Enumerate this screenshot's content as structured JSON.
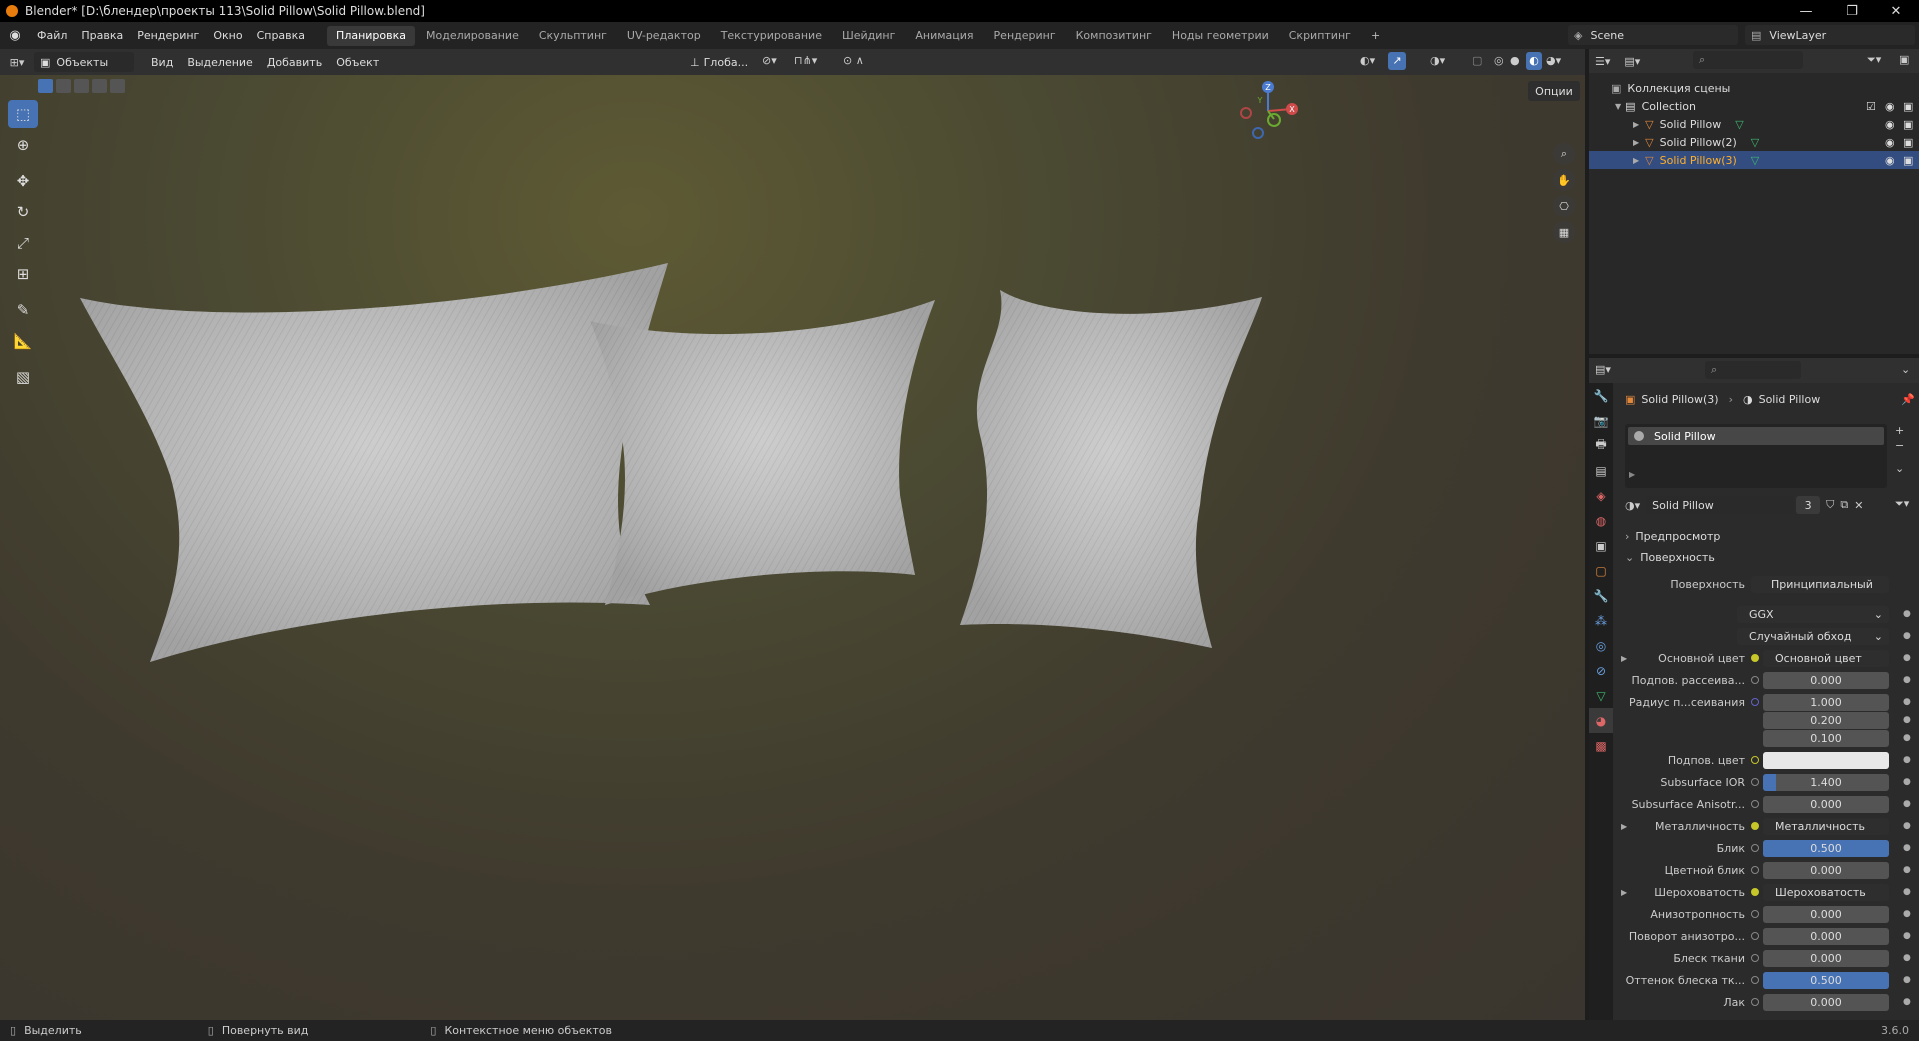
{
  "window": {
    "title": "Blender* [D:\\блендер\\проекты 113\\Solid Pillow\\Solid Pillow.blend]"
  },
  "menu": {
    "items": [
      "Файл",
      "Правка",
      "Рендеринг",
      "Окно",
      "Справка"
    ],
    "workspaces": [
      "Планировка",
      "Моделирование",
      "Скульптинг",
      "UV-редактор",
      "Текстурирование",
      "Шейдинг",
      "Анимация",
      "Рендеринг",
      "Композитинг",
      "Ноды геометрии",
      "Скриптинг"
    ],
    "active_workspace": "Планировка",
    "scene": "Scene",
    "view_layer": "ViewLayer"
  },
  "viewport": {
    "mode": "Объекты",
    "menus": [
      "Вид",
      "Выделение",
      "Добавить",
      "Объект"
    ],
    "orientation": "Глоба...",
    "options": "Опции",
    "gizmo_labels": {
      "x": "X",
      "y": "Y",
      "z": "Z"
    }
  },
  "outliner": {
    "root": "Коллекция сцены",
    "collection": "Collection",
    "objects": [
      "Solid Pillow",
      "Solid Pillow(2)",
      "Solid Pillow(3)"
    ],
    "selected_index": 2
  },
  "properties": {
    "breadcrumb_object": "Solid Pillow(3)",
    "breadcrumb_material": "Solid Pillow",
    "slot_name": "Solid Pillow",
    "material_name": "Solid Pillow",
    "user_count": "3",
    "section_preview": "Предпросмотр",
    "section_surface": "Поверхность",
    "surface_label": "Поверхность",
    "surface_value": "Принципиальный BSDF",
    "distribution": "GGX",
    "subsurface_method": "Случайный обход",
    "rows": [
      {
        "label": "Основной цвет",
        "value": "Основной цвет",
        "kind": "link",
        "expand": true
      },
      {
        "label": "Подпов. рассеива...",
        "value": "0.000",
        "kind": "num"
      },
      {
        "label": "Радиус п...сеивания",
        "value": "1.000",
        "kind": "num"
      },
      {
        "label": "",
        "value": "0.200",
        "kind": "num"
      },
      {
        "label": "",
        "value": "0.100",
        "kind": "num"
      },
      {
        "label": "Подпов. цвет",
        "value": "",
        "kind": "color"
      },
      {
        "label": "Subsurface IOR",
        "value": "1.400",
        "kind": "num",
        "fill": 0.1
      },
      {
        "label": "Subsurface Anisotr...",
        "value": "0.000",
        "kind": "num"
      },
      {
        "label": "Металличность",
        "value": "Металличность",
        "kind": "link",
        "expand": true
      },
      {
        "label": "Блик",
        "value": "0.500",
        "kind": "num",
        "fill": 1
      },
      {
        "label": "Цветной блик",
        "value": "0.000",
        "kind": "num"
      },
      {
        "label": "Шероховатость",
        "value": "Шероховатость",
        "kind": "link",
        "expand": true
      },
      {
        "label": "Анизотропность",
        "value": "0.000",
        "kind": "num"
      },
      {
        "label": "Поворот анизотро...",
        "value": "0.000",
        "kind": "num"
      },
      {
        "label": "Блеск ткани",
        "value": "0.000",
        "kind": "num"
      },
      {
        "label": "Оттенок блеска тк...",
        "value": "0.500",
        "kind": "num",
        "fill": 1
      },
      {
        "label": "Лак",
        "value": "0.000",
        "kind": "num"
      }
    ]
  },
  "status": {
    "select": "Выделить",
    "rotate": "Повернуть вид",
    "context": "Контекстное меню объектов",
    "version": "3.6.0"
  },
  "colors": {
    "accent": "#4772b3",
    "selection": "#334d80",
    "blender_orange": "#e87d0d"
  }
}
